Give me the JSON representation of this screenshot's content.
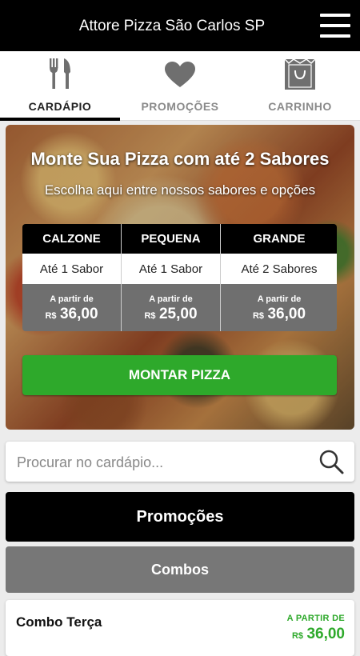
{
  "header": {
    "title": "Attore Pizza São Carlos SP",
    "menu_icon": "hamburger-menu-icon"
  },
  "tabs": [
    {
      "label": "CARDÁPIO",
      "icon": "fork-knife-icon",
      "active": true
    },
    {
      "label": "PROMOÇÕES",
      "icon": "heart-icon",
      "active": false
    },
    {
      "label": "CARRINHO",
      "icon": "shopping-bag-icon",
      "active": false
    }
  ],
  "hero": {
    "title": "Monte Sua Pizza com até 2 Sabores",
    "subtitle": "Escolha aqui entre nossos sabores e opções",
    "sizes": [
      {
        "name": "CALZONE",
        "flavors": "Até 1 Sabor",
        "from": "A partir de",
        "currency": "R$",
        "price": "36,00"
      },
      {
        "name": "PEQUENA",
        "flavors": "Até 1 Sabor",
        "from": "A partir de",
        "currency": "R$",
        "price": "25,00"
      },
      {
        "name": "GRANDE",
        "flavors": "Até 2 Sabores",
        "from": "A partir de",
        "currency": "R$",
        "price": "36,00"
      }
    ],
    "button_label": "MONTAR PIZZA"
  },
  "search": {
    "placeholder": "Procurar no cardápio...",
    "value": ""
  },
  "categories": [
    {
      "label": "Promoções"
    },
    {
      "label": "Combos"
    }
  ],
  "items": [
    {
      "name": "Combo Terça",
      "from": "A PARTIR DE",
      "currency": "R$",
      "price": "36,00"
    }
  ],
  "colors": {
    "accent_green": "#2ea92b",
    "header_black": "#000000",
    "category_gray": "#777777"
  }
}
